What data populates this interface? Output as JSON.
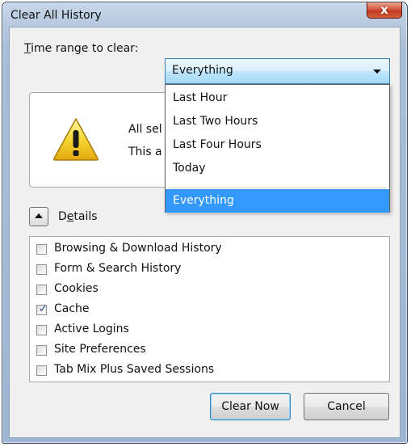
{
  "window": {
    "title": "Clear All History",
    "close_glyph": "x"
  },
  "time_range": {
    "label_accel": "T",
    "label_rest": "ime range to clear:",
    "selected_value": "Everything",
    "options": [
      "Last Hour",
      "Last Two Hours",
      "Last Four Hours",
      "Today",
      "Everything"
    ]
  },
  "warning": {
    "icon": "warning-triangle-icon",
    "line1_visible": "All sel",
    "line2_visible": "This a"
  },
  "details": {
    "label_first": "D",
    "label_accel": "e",
    "label_rest": "tails",
    "expanded": true
  },
  "items": [
    {
      "label": "Browsing & Download History",
      "checked": false
    },
    {
      "label": "Form & Search History",
      "checked": false
    },
    {
      "label": "Cookies",
      "checked": false
    },
    {
      "label": "Cache",
      "checked": true
    },
    {
      "label": "Active Logins",
      "checked": false
    },
    {
      "label": "Site Preferences",
      "checked": false
    },
    {
      "label": "Tab Mix Plus Saved Sessions",
      "checked": false
    }
  ],
  "buttons": {
    "clear_now": "Clear Now",
    "cancel": "Cancel"
  },
  "colors": {
    "selection": "#3399ff",
    "close_button": "#c23a22",
    "frame": "#a9bfd8"
  }
}
